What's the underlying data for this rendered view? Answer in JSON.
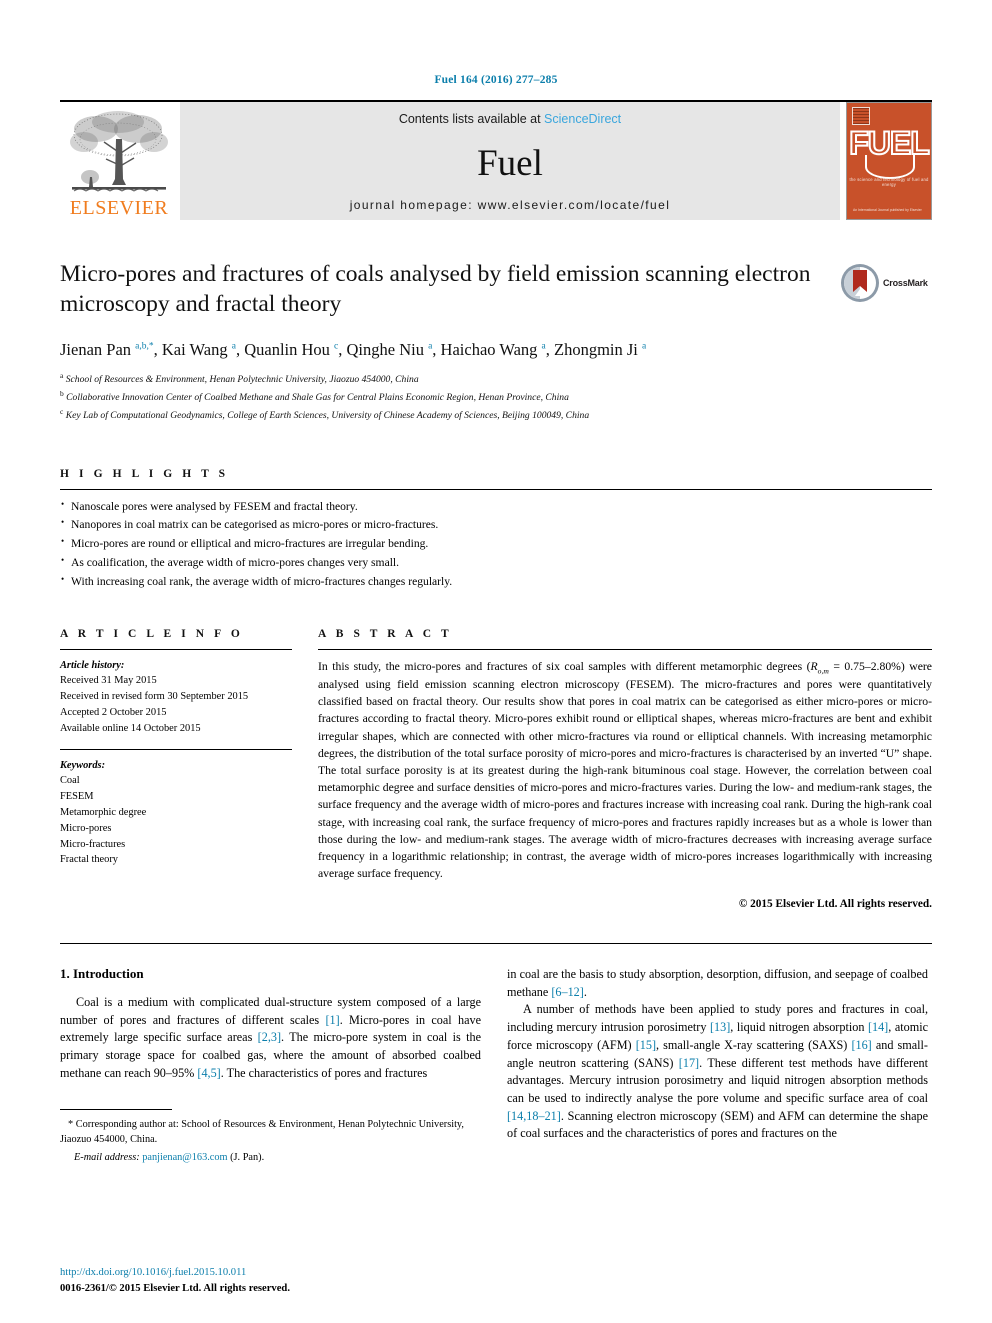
{
  "running_head": "Fuel 164 (2016) 277–285",
  "masthead": {
    "elsevier_wordmark": "ELSEVIER",
    "contents_prefix": "Contents lists available at ",
    "sciencedirect": "ScienceDirect",
    "journal_name": "Fuel",
    "homepage": "journal homepage: www.elsevier.com/locate/fuel",
    "cover": {
      "title": "FUEL",
      "subtitle": "the science and technology of fuel and energy",
      "bottom_text": "An International Journal published by Elsevier"
    }
  },
  "article": {
    "title": "Micro-pores and fractures of coals analysed by field emission scanning electron microscopy and fractal theory",
    "crossmark_label": "CrossMark",
    "authors_html": "Jienan Pan <sup>a,b,</sup><sup>*</sup>, Kai Wang <sup>a</sup>, Quanlin Hou <sup>c</sup>, Qinghe Niu <sup>a</sup>, Haichao Wang <sup>a</sup>, Zhongmin Ji <sup>a</sup>",
    "affiliations": [
      {
        "marker": "a",
        "text": "School of Resources & Environment, Henan Polytechnic University, Jiaozuo 454000, China"
      },
      {
        "marker": "b",
        "text": "Collaborative Innovation Center of Coalbed Methane and Shale Gas for Central Plains Economic Region, Henan Province, China"
      },
      {
        "marker": "c",
        "text": "Key Lab of Computational Geodynamics, College of Earth Sciences, University of Chinese Academy of Sciences, Beijing 100049, China"
      }
    ]
  },
  "highlights": {
    "heading": "H I G H L I G H T S",
    "items": [
      "Nanoscale pores were analysed by FESEM and fractal theory.",
      "Nanopores in coal matrix can be categorised as micro-pores or micro-fractures.",
      "Micro-pores are round or elliptical and micro-fractures are irregular bending.",
      "As coalification, the average width of micro-pores changes very small.",
      "With increasing coal rank, the average width of micro-fractures changes regularly."
    ]
  },
  "article_info": {
    "heading": "A R T I C L E    I N F O",
    "history_label": "Article history:",
    "history": [
      "Received 31 May 2015",
      "Received in revised form 30 September 2015",
      "Accepted 2 October 2015",
      "Available online 14 October 2015"
    ],
    "keywords_label": "Keywords:",
    "keywords": [
      "Coal",
      "FESEM",
      "Metamorphic degree",
      "Micro-pores",
      "Micro-fractures",
      "Fractal theory"
    ]
  },
  "abstract": {
    "heading": "A B S T R A C T",
    "text_part1": "In this study, the micro-pores and fractures of six coal samples with different metamorphic degrees (",
    "ro_symbol": "R",
    "ro_sub": "o,m",
    "text_part2": " = 0.75–2.80%) were analysed using field emission scanning electron microscopy (FESEM). The micro-fractures and pores were quantitatively classified based on fractal theory. Our results show that pores in coal matrix can be categorised as either micro-pores or micro-fractures according to fractal theory. Micro-pores exhibit round or elliptical shapes, whereas micro-fractures are bent and exhibit irregular shapes, which are connected with other micro-fractures via round or elliptical channels. With increasing metamorphic degrees, the distribution of the total surface porosity of micro-pores and micro-fractures is characterised by an inverted “U” shape. The total surface porosity is at its greatest during the high-rank bituminous coal stage. However, the correlation between coal metamorphic degree and surface densities of micro-pores and micro-fractures varies. During the low- and medium-rank stages, the surface frequency and the average width of micro-pores and fractures increase with increasing coal rank. During the high-rank coal stage, with increasing coal rank, the surface frequency of micro-pores and fractures rapidly increases but as a whole is lower than those during the low- and medium-rank stages. The average width of micro-fractures decreases with increasing average surface frequency in a logarithmic relationship; in contrast, the average width of micro-pores increases logarithmically with increasing average surface frequency.",
    "copyright": "© 2015 Elsevier Ltd. All rights reserved."
  },
  "introduction": {
    "heading": "1. Introduction",
    "left_para1_a": "Coal is a medium with complicated dual-structure system composed of a large number of pores and fractures of different scales ",
    "left_ref1": "[1]",
    "left_para1_b": ". Micro-pores in coal have extremely large specific surface areas ",
    "left_ref2": "[2,3]",
    "left_para1_c": ". The micro-pore system in coal is the primary storage space for coalbed gas, where the amount of absorbed coalbed methane can reach 90–95% ",
    "left_ref3": "[4,5]",
    "left_para1_d": ". The characteristics of pores and fractures",
    "right_para1_a": "in coal are the basis to study absorption, desorption, diffusion, and seepage of coalbed methane ",
    "right_ref1": "[6–12]",
    "right_para1_b": ".",
    "right_para2_a": "A number of methods have been applied to study pores and fractures in coal, including mercury intrusion porosimetry ",
    "right_ref2": "[13]",
    "right_para2_b": ", liquid nitrogen absorption ",
    "right_ref3": "[14]",
    "right_para2_c": ", atomic force microscopy (AFM) ",
    "right_ref4": "[15]",
    "right_para2_d": ", small-angle X-ray scattering (SAXS) ",
    "right_ref5": "[16]",
    "right_para2_e": " and small-angle neutron scattering (SANS) ",
    "right_ref6": "[17]",
    "right_para2_f": ". These different test methods have different advantages. Mercury intrusion porosimetry and liquid nitrogen absorption methods can be used to indirectly analyse the pore volume and specific surface area of coal ",
    "right_ref7": "[14,18–21]",
    "right_para2_g": ". Scanning electron microscopy (SEM) and AFM can determine the shape of coal surfaces and the characteristics of pores and fractures on the"
  },
  "footnote": {
    "star": "*",
    "corresponding": " Corresponding author at: School of Resources & Environment, Henan Polytechnic University, Jiaozuo 454000, China.",
    "email_label": "E-mail address:",
    "email": "panjienan@163.com",
    "email_suffix": " (J. Pan)."
  },
  "page_footer": {
    "doi": "http://dx.doi.org/10.1016/j.fuel.2015.10.011",
    "issn": "0016-2361/© 2015 Elsevier Ltd. All rights reserved."
  },
  "colors": {
    "link_blue": "#0b7eab",
    "sciencedirect_blue": "#3aa6dd",
    "elsevier_orange": "#f07c1e",
    "cover_orange": "#c8512a"
  }
}
